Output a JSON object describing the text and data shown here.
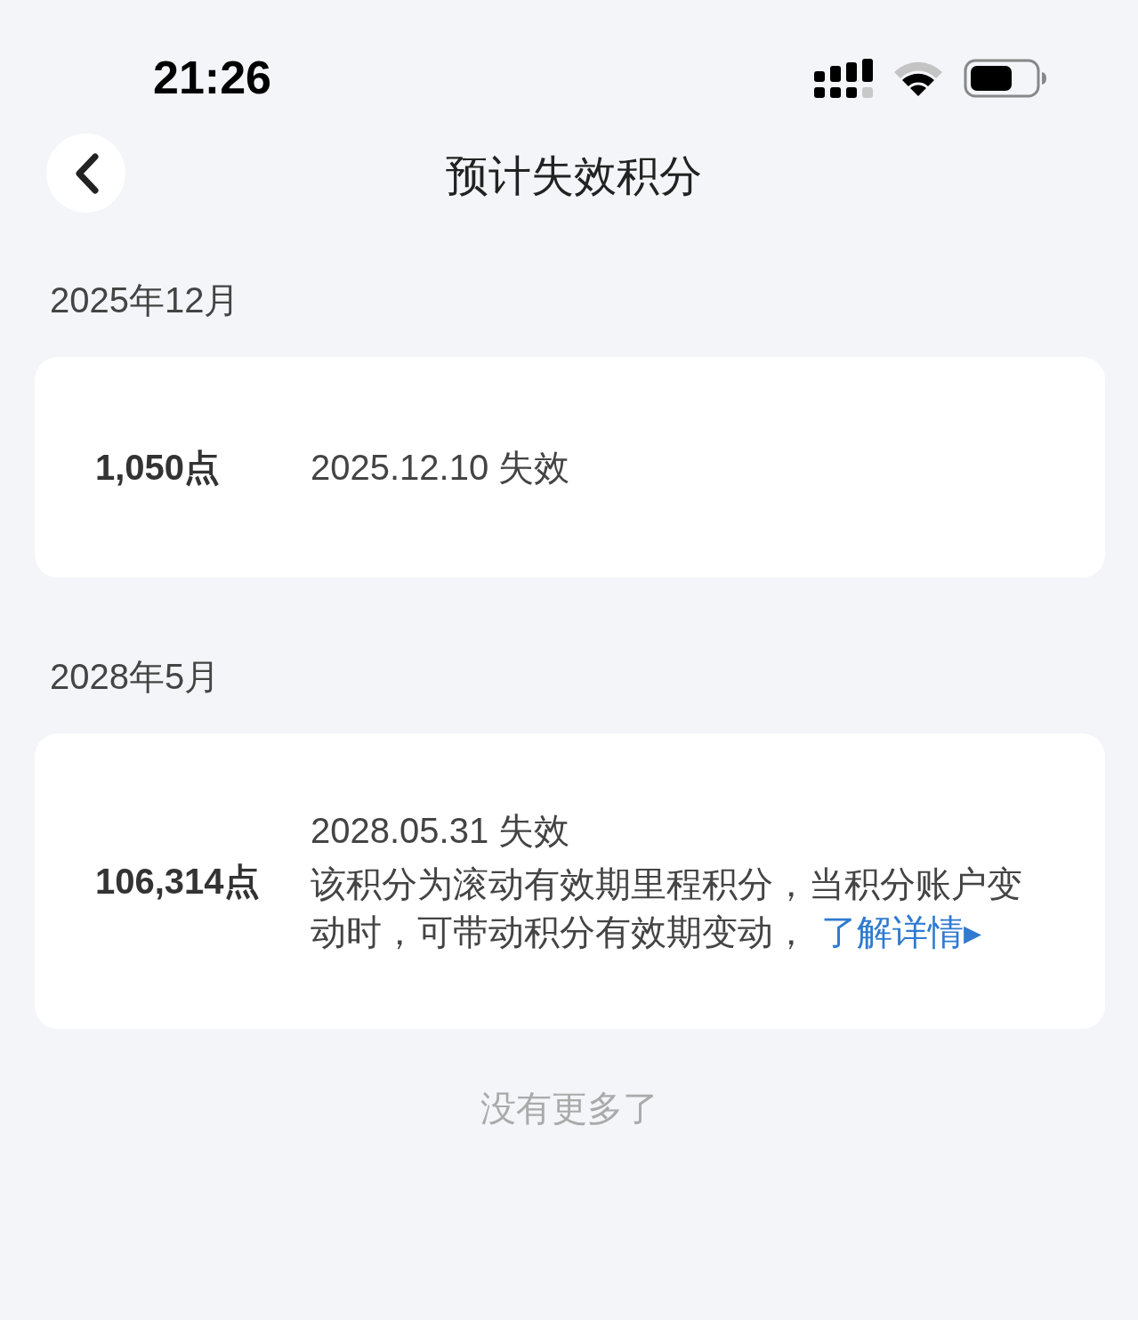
{
  "status_bar": {
    "time": "21:26"
  },
  "header": {
    "title": "预计失效积分"
  },
  "groups": [
    {
      "month": "2025年12月",
      "entries": [
        {
          "points": "1,050点",
          "expiry": "2025.12.10 失效"
        }
      ]
    },
    {
      "month": "2028年5月",
      "entries": [
        {
          "points": "106,314点",
          "expiry": "2028.05.31 失效",
          "note": "该积分为滚动有效期里程积分，当积分账户变动时，可带动积分有效期变动，",
          "link": "了解详情▸"
        }
      ]
    }
  ],
  "footer": "没有更多了"
}
